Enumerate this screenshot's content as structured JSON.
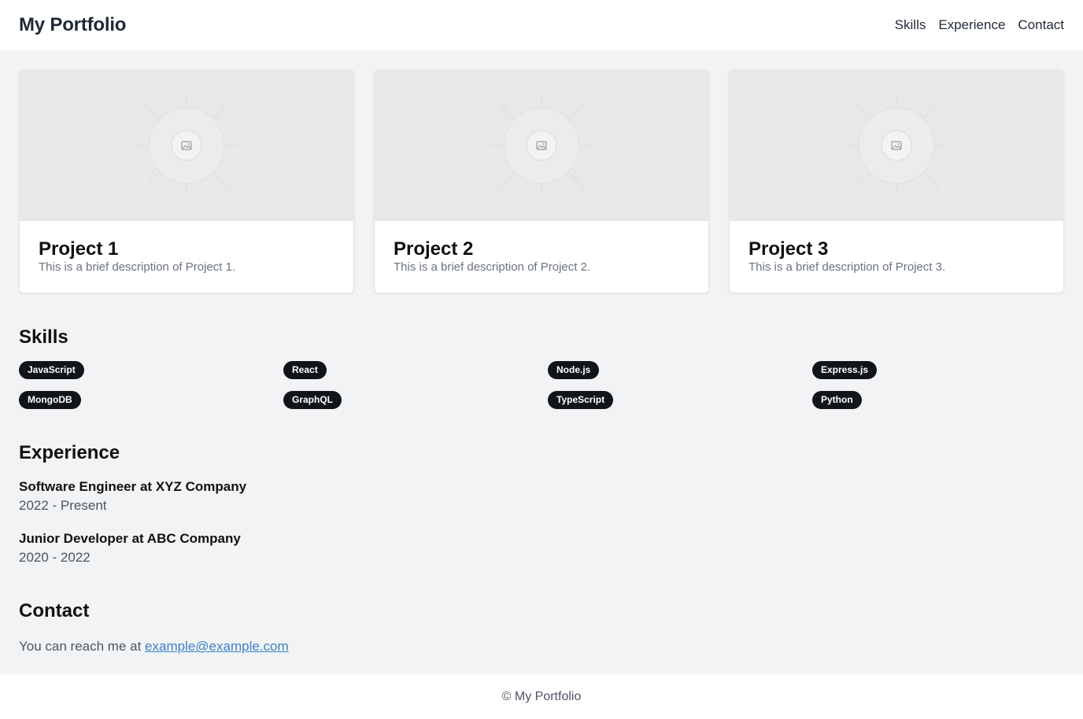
{
  "header": {
    "brand": "My Portfolio",
    "nav": [
      "Skills",
      "Experience",
      "Contact"
    ]
  },
  "projects": [
    {
      "title": "Project 1",
      "description": "This is a brief description of Project 1.",
      "image_icon": "image-placeholder-icon"
    },
    {
      "title": "Project 2",
      "description": "This is a brief description of Project 2.",
      "image_icon": "image-placeholder-icon"
    },
    {
      "title": "Project 3",
      "description": "This is a brief description of Project 3.",
      "image_icon": "image-placeholder-icon"
    }
  ],
  "skills": {
    "title": "Skills",
    "items": [
      "JavaScript",
      "React",
      "Node.js",
      "Express.js",
      "MongoDB",
      "GraphQL",
      "TypeScript",
      "Python"
    ]
  },
  "experience": {
    "title": "Experience",
    "items": [
      {
        "role": "Software Engineer at XYZ Company",
        "dates": "2022 - Present"
      },
      {
        "role": "Junior Developer at ABC Company",
        "dates": "2020 - 2022"
      }
    ]
  },
  "contact": {
    "title": "Contact",
    "text": "You can reach me at",
    "email": "example@example.com"
  },
  "footer": {
    "text": "© My Portfolio"
  },
  "colors": {
    "background": "#f2f3f5",
    "chip": "#111418",
    "link": "#3b82c4"
  }
}
